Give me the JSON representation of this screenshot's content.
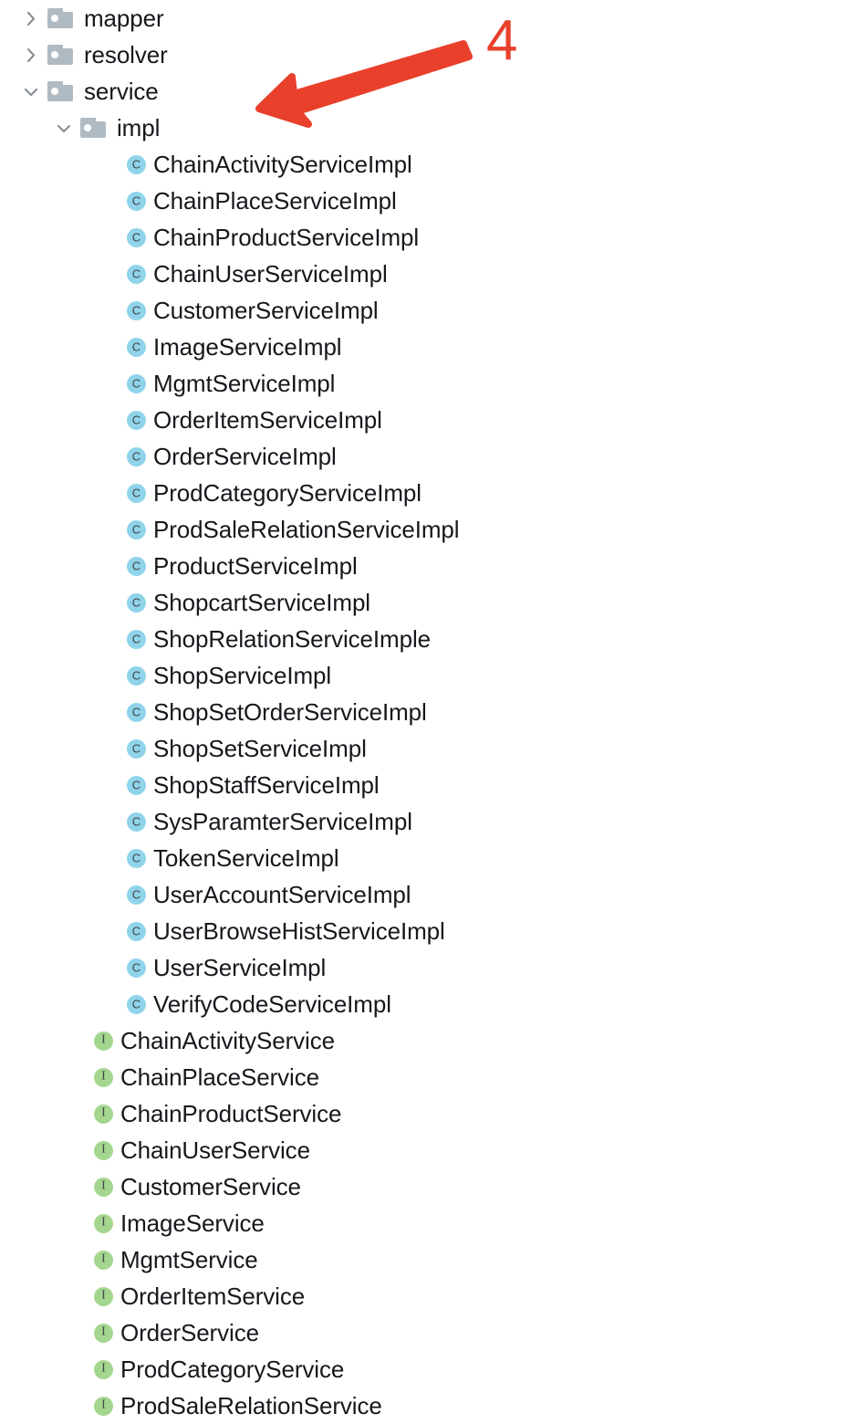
{
  "annotation": {
    "number_label": "4",
    "color": "#e8402a",
    "arrow_icon": "left-arrow-icon",
    "points_at": "service"
  },
  "icons": {
    "folder": "folder-icon",
    "chevron_collapsed": "chevron-right-icon",
    "chevron_expanded": "chevron-down-icon",
    "class": "class-icon",
    "interface": "interface-icon"
  },
  "colors": {
    "class_icon_bg": "#8fd4ea",
    "interface_icon_bg": "#a5d68f",
    "folder_icon": "#b0bac3",
    "chevron": "#868e96",
    "text": "#15181c",
    "annotation": "#e8402a"
  },
  "glyphs": {
    "class": "C",
    "interface": "I"
  },
  "tree": {
    "rows": [
      {
        "label": "mapper",
        "kind": "folder",
        "level": 1,
        "expanded": false
      },
      {
        "label": "resolver",
        "kind": "folder",
        "level": 1,
        "expanded": false
      },
      {
        "label": "service",
        "kind": "folder",
        "level": 1,
        "expanded": true
      },
      {
        "label": "impl",
        "kind": "folder",
        "level": 2,
        "expanded": true
      },
      {
        "label": "ChainActivityServiceImpl",
        "kind": "class",
        "level": 3
      },
      {
        "label": "ChainPlaceServiceImpl",
        "kind": "class",
        "level": 3
      },
      {
        "label": "ChainProductServiceImpl",
        "kind": "class",
        "level": 3
      },
      {
        "label": "ChainUserServiceImpl",
        "kind": "class",
        "level": 3
      },
      {
        "label": "CustomerServiceImpl",
        "kind": "class",
        "level": 3
      },
      {
        "label": "ImageServiceImpl",
        "kind": "class",
        "level": 3
      },
      {
        "label": "MgmtServiceImpl",
        "kind": "class",
        "level": 3
      },
      {
        "label": "OrderItemServiceImpl",
        "kind": "class",
        "level": 3
      },
      {
        "label": "OrderServiceImpl",
        "kind": "class",
        "level": 3
      },
      {
        "label": "ProdCategoryServiceImpl",
        "kind": "class",
        "level": 3
      },
      {
        "label": "ProdSaleRelationServiceImpl",
        "kind": "class",
        "level": 3
      },
      {
        "label": "ProductServiceImpl",
        "kind": "class",
        "level": 3
      },
      {
        "label": "ShopcartServiceImpl",
        "kind": "class",
        "level": 3
      },
      {
        "label": "ShopRelationServiceImple",
        "kind": "class",
        "level": 3
      },
      {
        "label": "ShopServiceImpl",
        "kind": "class",
        "level": 3
      },
      {
        "label": "ShopSetOrderServiceImpl",
        "kind": "class",
        "level": 3
      },
      {
        "label": "ShopSetServiceImpl",
        "kind": "class",
        "level": 3
      },
      {
        "label": "ShopStaffServiceImpl",
        "kind": "class",
        "level": 3
      },
      {
        "label": "SysParamterServiceImpl",
        "kind": "class",
        "level": 3
      },
      {
        "label": "TokenServiceImpl",
        "kind": "class",
        "level": 3
      },
      {
        "label": "UserAccountServiceImpl",
        "kind": "class",
        "level": 3
      },
      {
        "label": "UserBrowseHistServiceImpl",
        "kind": "class",
        "level": 3
      },
      {
        "label": "UserServiceImpl",
        "kind": "class",
        "level": 3
      },
      {
        "label": "VerifyCodeServiceImpl",
        "kind": "class",
        "level": 3
      },
      {
        "label": "ChainActivityService",
        "kind": "interface",
        "level": 2
      },
      {
        "label": "ChainPlaceService",
        "kind": "interface",
        "level": 2
      },
      {
        "label": "ChainProductService",
        "kind": "interface",
        "level": 2
      },
      {
        "label": "ChainUserService",
        "kind": "interface",
        "level": 2
      },
      {
        "label": "CustomerService",
        "kind": "interface",
        "level": 2
      },
      {
        "label": "ImageService",
        "kind": "interface",
        "level": 2
      },
      {
        "label": "MgmtService",
        "kind": "interface",
        "level": 2
      },
      {
        "label": "OrderItemService",
        "kind": "interface",
        "level": 2
      },
      {
        "label": "OrderService",
        "kind": "interface",
        "level": 2
      },
      {
        "label": "ProdCategoryService",
        "kind": "interface",
        "level": 2
      },
      {
        "label": "ProdSaleRelationService",
        "kind": "interface",
        "level": 2
      }
    ]
  }
}
